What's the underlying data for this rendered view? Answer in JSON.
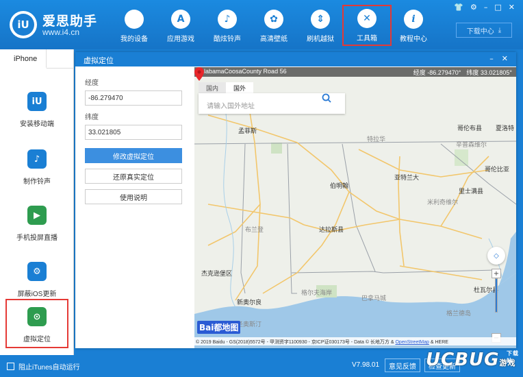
{
  "brand": {
    "name": "爱思助手",
    "url": "www.i4.cn",
    "logo_glyph": "iU"
  },
  "nav": [
    {
      "label": "我的设备",
      "icon": "apple-icon",
      "glyph": ""
    },
    {
      "label": "应用游戏",
      "icon": "app-store-icon",
      "glyph": "A"
    },
    {
      "label": "酷炫铃声",
      "icon": "bell-icon",
      "glyph": "♪"
    },
    {
      "label": "高清壁纸",
      "icon": "wallpaper-icon",
      "glyph": "✿"
    },
    {
      "label": "刷机越狱",
      "icon": "flash-jailbreak-icon",
      "glyph": "⇕"
    },
    {
      "label": "工具箱",
      "icon": "toolbox-icon",
      "glyph": "✕",
      "active": true
    },
    {
      "label": "教程中心",
      "icon": "info-icon",
      "glyph": "i"
    }
  ],
  "window_controls": {
    "shirt": "👕",
    "gear": "⚙",
    "minimize": "–",
    "maximize": "□",
    "close": "✕"
  },
  "download_center": {
    "label": "下载中心",
    "arrow": "⤓"
  },
  "sidebar": {
    "device_tab": "iPhone",
    "items": [
      {
        "label": "安装移动端",
        "icon": "i4-app-icon",
        "glyph": "iU",
        "color": "#1a7fd4"
      },
      {
        "label": "制作铃声",
        "icon": "bell-plus-icon",
        "glyph": "♪",
        "color": "#1a7fd4"
      },
      {
        "label": "手机投屏直播",
        "icon": "screen-mirror-icon",
        "glyph": "▶",
        "color": "#2e9c4f"
      },
      {
        "label": "屏蔽iOS更新",
        "icon": "gear-block-icon",
        "glyph": "⚙",
        "color": "#1a7fd4"
      },
      {
        "label": "虚拟定位",
        "icon": "location-pin-icon",
        "glyph": "⊙",
        "color": "#2e9c4f",
        "active": true
      }
    ]
  },
  "dialog": {
    "title": "虚拟定位",
    "controls": {
      "minimize": "–",
      "close": "✕"
    },
    "longitude_label": "经度",
    "longitude_value": "-86.279470",
    "latitude_label": "纬度",
    "latitude_value": "33.021805",
    "modify_button": "修改虚拟定位",
    "restore_button": "还原真实定位",
    "help_button": "使用说明"
  },
  "map": {
    "road_name": "AlabamaCoosaCounty Road 56",
    "longitude_readout": "经度 -86.279470°",
    "latitude_readout": "纬度 33.021805°",
    "tab_domestic": "国内",
    "tab_foreign": "国外",
    "search_placeholder": "请输入国外地址",
    "cities": [
      {
        "name": "孟菲斯",
        "light": false
      },
      {
        "name": "伯明翰",
        "light": false
      },
      {
        "name": "亚特兰大",
        "light": false
      },
      {
        "name": "哥伦布县",
        "light": false
      },
      {
        "name": "夏洛特",
        "light": false
      },
      {
        "name": "哥伦比亚",
        "light": false
      },
      {
        "name": "里士满县",
        "light": false
      },
      {
        "name": "达拉斯县",
        "light": false
      },
      {
        "name": "杰克逊堡区",
        "light": false
      },
      {
        "name": "新奥尔良",
        "light": false
      },
      {
        "name": "杜瓦尔县",
        "light": false
      },
      {
        "name": "特拉华",
        "light": true
      },
      {
        "name": "辛普森维尔",
        "light": true
      },
      {
        "name": "米利奇维尔",
        "light": true
      },
      {
        "name": "布兰登",
        "light": true
      },
      {
        "name": "格尔夫海岸",
        "light": true
      },
      {
        "name": "巴拿马城",
        "light": true
      },
      {
        "name": "圣奥斯汀",
        "light": true
      },
      {
        "name": "格兰德岛",
        "light": true
      }
    ],
    "baidu_logo": "Bai都地图",
    "copyright": "© 2019 Baidu - GS(2018)5572号 - 甲测资字1100930 - 京ICP证030173号 - Data © 长地万方 & ",
    "copyright_link": "OpenStreetMap",
    "copyright_tail": " & HERE"
  },
  "statusbar": {
    "itunes_checkbox": "阻止iTunes自动运行",
    "version": "V7.98.01",
    "feedback": "意见反馈",
    "check_update": "检查更新"
  },
  "watermark": {
    "text": "UCBUG",
    "suffix": "游戏网",
    "small": "下载站"
  },
  "colors": {
    "primary": "#1a7fd4",
    "highlight": "#e53935",
    "map_pin": "#e8262a",
    "water": "#9fc8e8"
  }
}
